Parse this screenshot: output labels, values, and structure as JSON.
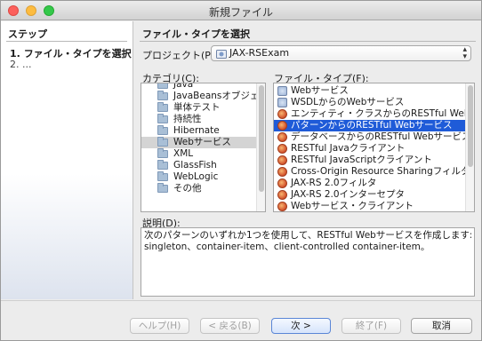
{
  "window": {
    "title": "新規ファイル"
  },
  "steps": {
    "title": "ステップ",
    "items": [
      {
        "number": "1.",
        "label": "ファイル・タイプを選択"
      },
      {
        "number": "2.",
        "label": "..."
      }
    ]
  },
  "main": {
    "section_title": "ファイル・タイプを選択",
    "project_label": "プロジェクト(P):",
    "project_value": "JAX-RSExam",
    "categories_label": "カテゴリ(C):",
    "file_types_label": "ファイル・タイプ(F):",
    "categories": [
      {
        "label": "Java"
      },
      {
        "label": "JavaBeansオブジェクト"
      },
      {
        "label": "単体テスト"
      },
      {
        "label": "持続性"
      },
      {
        "label": "Hibernate"
      },
      {
        "label": "Webサービス",
        "selected": true
      },
      {
        "label": "XML"
      },
      {
        "label": "GlassFish"
      },
      {
        "label": "WebLogic"
      },
      {
        "label": "その他"
      }
    ],
    "file_types": [
      {
        "label": "Webサービス",
        "icon": "web-service-icon"
      },
      {
        "label": "WSDLからのWebサービス",
        "icon": "web-service-icon"
      },
      {
        "label": "エンティティ・クラスからのRESTful Webサービス",
        "icon": "java-icon"
      },
      {
        "label": "パターンからのRESTful Webサービス",
        "icon": "java-icon",
        "selected": true
      },
      {
        "label": "データベースからのRESTful Webサービス",
        "icon": "java-icon"
      },
      {
        "label": "RESTful Javaクライアント",
        "icon": "java-icon"
      },
      {
        "label": "RESTful JavaScriptクライアント",
        "icon": "java-icon"
      },
      {
        "label": "Cross-Origin Resource Sharingフィルタ",
        "icon": "java-icon"
      },
      {
        "label": "JAX-RS 2.0フィルタ",
        "icon": "java-icon"
      },
      {
        "label": "JAX-RS 2.0インターセプタ",
        "icon": "java-icon"
      },
      {
        "label": "Webサービス・クライアント",
        "icon": "java-icon"
      }
    ],
    "description_label": "説明(D):",
    "description_lines": [
      "次のパターンのいずれか1つを使用して、RESTful Webサービスを作成します:",
      "singleton、container-item、client-controlled container-item。"
    ]
  },
  "buttons": {
    "help": "ヘルプ(H)",
    "back": "< 戻る(B)",
    "next": "次 >",
    "finish": "終了(F)",
    "cancel": "取消"
  },
  "colors": {
    "selection_blue": "#1f5bd8",
    "selection_gray": "#d4d4d4",
    "window_bg": "#ececec"
  }
}
